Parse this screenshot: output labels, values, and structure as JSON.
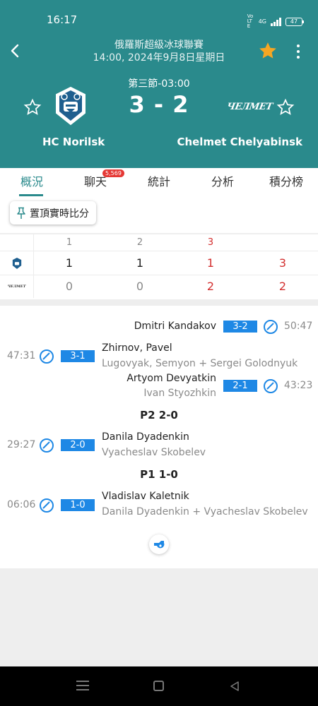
{
  "status": {
    "time": "16:17",
    "net_label": "Vo LTE",
    "net_type": "4G",
    "battery": "47"
  },
  "header": {
    "league": "俄羅斯超級冰球聯賽",
    "match_time": "14:00, 2024年9月8日星期日",
    "period_info": "第三節-03:00",
    "score": "3 - 2",
    "home_team": "HC Norilsk",
    "away_team": "Chelmet Chelyabinsk",
    "away_logo_text": "ЧЕЛМЕТ",
    "favorite_color": "#f5a623"
  },
  "tabs": [
    {
      "label": "概況",
      "active": true
    },
    {
      "label": "聊天",
      "badge": "5,569"
    },
    {
      "label": "統計"
    },
    {
      "label": "分析"
    },
    {
      "label": "積分榜"
    }
  ],
  "pin_button": {
    "label": "置頂實時比分"
  },
  "period_table": {
    "headers": [
      "1",
      "2",
      "3"
    ],
    "home": [
      "1",
      "1",
      "1",
      "3"
    ],
    "away": [
      "0",
      "0",
      "2",
      "2"
    ],
    "away_logo_text": "ЧЕЛМЕТ"
  },
  "events": [
    {
      "side": "home",
      "time": "50:47",
      "score": "3-2",
      "scorer": "Dmitri Kandakov",
      "assist": ""
    },
    {
      "side": "away",
      "time": "47:31",
      "score": "3-1",
      "scorer": "Zhirnov, Pavel",
      "assist": "Lugovyak, Semyon + Sergei Golodnyuk"
    },
    {
      "side": "home",
      "time": "43:23",
      "score": "2-1",
      "scorer": "Artyom Devyatkin",
      "assist": "Ivan Styozhkin"
    },
    {
      "period_label": "P2 2-0"
    },
    {
      "side": "away",
      "time": "29:27",
      "score": "2-0",
      "scorer": "Danila Dyadenkin",
      "assist": "Vyacheslav Skobelev"
    },
    {
      "period_label": "P1 1-0"
    },
    {
      "side": "away",
      "time": "06:06",
      "score": "1-0",
      "scorer": "Vladislav Kaletnik",
      "assist": "Danila Dyadenkin + Vyacheslav Skobelev"
    }
  ],
  "colors": {
    "header_bg": "#2a8a8c",
    "score_tag": "#1e88e5",
    "accent_red": "#d32f2f"
  }
}
